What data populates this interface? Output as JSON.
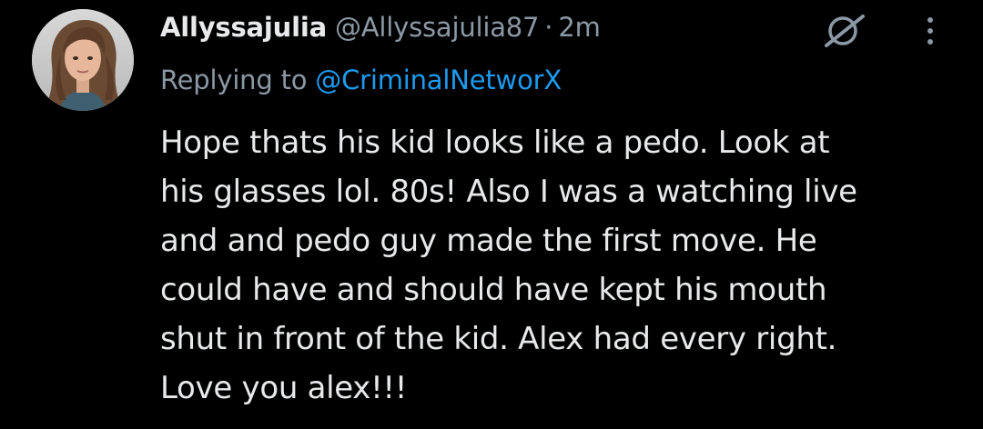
{
  "tweet": {
    "author": {
      "display_name": "Allyssajulia",
      "handle": "@Allyssajulia87"
    },
    "separator": "·",
    "timestamp": "2m",
    "reply": {
      "prefix": "Replying to",
      "target": "@CriminalNetworX"
    },
    "body_lines": [
      "Hope thats his kid looks like a pedo. Look at",
      "his glasses lol. 80s! Also I was a watching live",
      "and and pedo guy made the first move. He",
      "could have and should have kept his mouth",
      "shut in front of the kid. Alex had every right.",
      "Love you alex!!!"
    ]
  },
  "icons": {
    "avatar": "profile-avatar",
    "grok": "grok-icon",
    "more": "more-options-icon"
  },
  "colors": {
    "background": "#000000",
    "primary_text": "#e7e9ea",
    "secondary_text": "#8b98a5",
    "link": "#1d9bf0"
  }
}
